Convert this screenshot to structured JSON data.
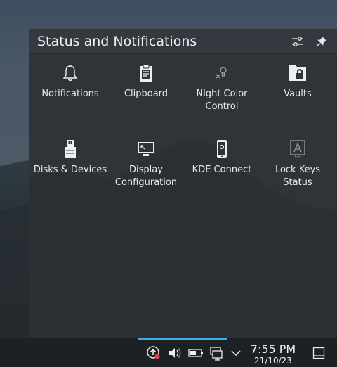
{
  "popup": {
    "title": "Status and Notifications",
    "configure_icon": "sliders-icon",
    "pin_icon": "pin-icon"
  },
  "items": [
    {
      "label": "Notifications",
      "icon": "bell-icon"
    },
    {
      "label": "Clipboard",
      "icon": "clipboard-icon"
    },
    {
      "label": "Night Color Control",
      "icon": "night-color-icon"
    },
    {
      "label": "Vaults",
      "icon": "vault-lock-icon"
    },
    {
      "label": "Disks & Devices",
      "icon": "usb-drive-icon"
    },
    {
      "label": "Display Configuration",
      "icon": "display-icon"
    },
    {
      "label": "KDE Connect",
      "icon": "phone-icon"
    },
    {
      "label": "Lock Keys Status",
      "icon": "caps-lock-icon"
    }
  ],
  "panel": {
    "time": "7:55 PM",
    "date": "21/10/23",
    "tray_icons": [
      "updates-icon",
      "volume-icon",
      "battery-icon",
      "network-icon",
      "chevron-down-icon",
      "show-desktop-icon"
    ],
    "accent": "#3daee9",
    "notification_dot": "#da4453"
  }
}
